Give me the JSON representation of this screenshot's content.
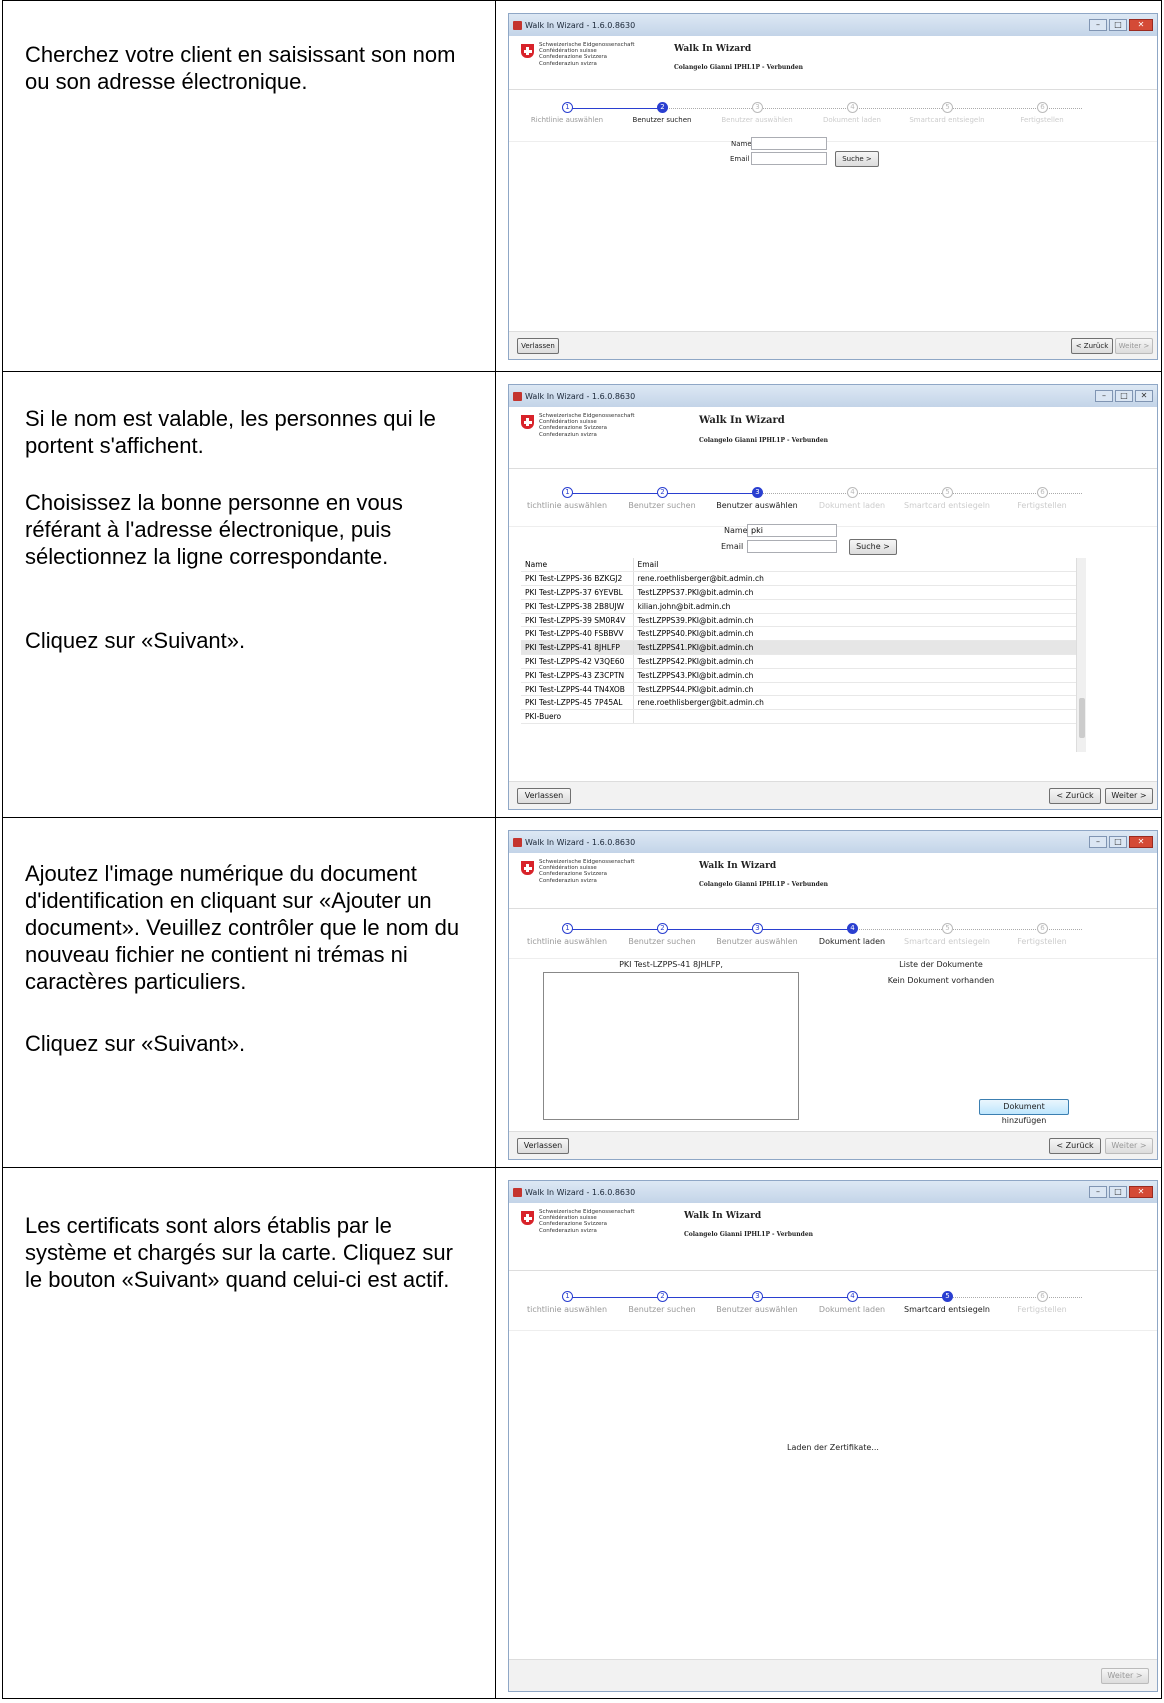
{
  "sections": [
    {
      "paragraphs": [
        "Cherchez votre client en saisissant son nom ou son adresse électronique."
      ]
    },
    {
      "paragraphs": [
        "Si le nom est valable, les personnes qui le portent s'affichent.",
        "Choisissez la bonne personne en vous référant à l'adresse électronique, puis sélectionnez la ligne correspondante.",
        "Cliquez sur «Suivant»."
      ]
    },
    {
      "paragraphs": [
        "Ajoutez l'image numérique du document d'identification en cliquant sur «Ajouter un document». Veuillez contrôler que le nom du nouveau fichier ne contient ni trémas ni caractères particuliers.",
        "Cliquez sur «Suivant»."
      ]
    },
    {
      "paragraphs": [
        "Les certificats sont alors établis par le système et chargés sur la carte. Cliquez sur le bouton «Suivant» quand celui-ci est actif."
      ]
    }
  ],
  "wizard": {
    "window_title": "Walk In Wizard - 1.6.0.8630",
    "app_title": "Walk In Wizard",
    "user_status": "Colangelo Gianni IPHL1P - Verbunden",
    "confederation_lines": [
      "Schweizerische Eidgenossenschaft",
      "Confédération suisse",
      "Confederazione Svizzera",
      "Confederaziun svizra"
    ],
    "steps_full": [
      "Richtlinie auswählen",
      "Benutzer suchen",
      "Benutzer auswählen",
      "Dokument laden",
      "Smartcard entsiegeln",
      "Fertigstellen"
    ],
    "steps_cut": [
      "tichtlinie auswählen",
      "Benutzer suchen",
      "Benutzer auswählen",
      "Dokument laden",
      "Smartcard entsiegeln",
      "Fertigstellen"
    ],
    "step_numbers": [
      "1",
      "2",
      "3",
      "4",
      "5",
      "6"
    ],
    "name_label": "Name",
    "email_label": "Email",
    "search_button": "Suche >",
    "leave_button": "Verlassen",
    "back_button": "< Zurück",
    "next_button": "Weiter >",
    "search_value": "pki",
    "results_headers": [
      "Name",
      "Email"
    ],
    "results": [
      [
        "PKI Test-LZPPS-36 BZKGJ2",
        "rene.roethlisberger@bit.admin.ch"
      ],
      [
        "PKI Test-LZPPS-37 6YEVBL",
        "TestLZPPS37.PKI@bit.admin.ch"
      ],
      [
        "PKI Test-LZPPS-38 2B8UJW",
        "kilian.john@bit.admin.ch"
      ],
      [
        "PKI Test-LZPPS-39 SM0R4V",
        "TestLZPPS39.PKI@bit.admin.ch"
      ],
      [
        "PKI Test-LZPPS-40 FSBBVV",
        "TestLZPPS40.PKI@bit.admin.ch"
      ],
      [
        "PKI Test-LZPPS-41 8JHLFP",
        "TestLZPPS41.PKI@bit.admin.ch"
      ],
      [
        "PKI Test-LZPPS-42 V3QE60",
        "TestLZPPS42.PKI@bit.admin.ch"
      ],
      [
        "PKI Test-LZPPS-43 Z3CPTN",
        "TestLZPPS43.PKI@bit.admin.ch"
      ],
      [
        "PKI Test-LZPPS-44 TN4XOB",
        "TestLZPPS44.PKI@bit.admin.ch"
      ],
      [
        "PKI Test-LZPPS-45 7P45AL",
        "rene.roethlisberger@bit.admin.ch"
      ],
      [
        "PKI-Buero",
        ""
      ]
    ],
    "selected_person": "PKI Test-LZPPS-41 8JHLFP,",
    "doc_list_title": "Liste der Dokumente",
    "no_document": "Kein Dokument vorhanden",
    "add_document_button": "Dokument hinzufügen",
    "loading_text": "Laden der Zertifikate..."
  }
}
